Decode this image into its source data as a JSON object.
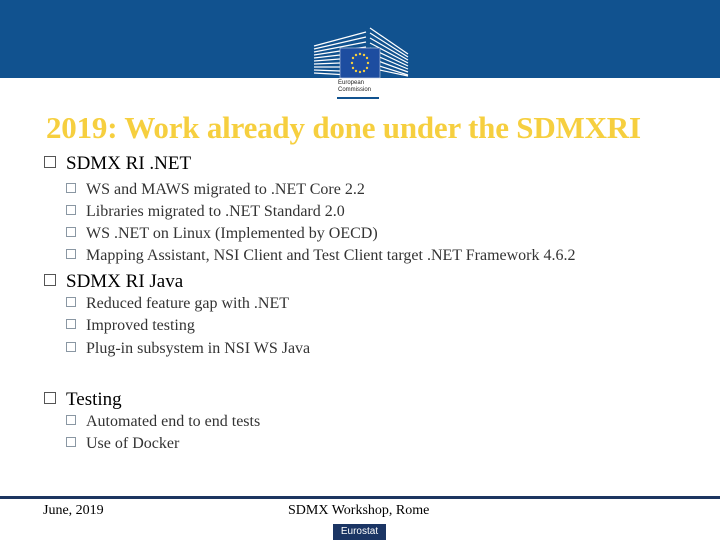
{
  "header": {
    "logo": {
      "name": "european-commission-logo",
      "text_line1": "European",
      "text_line2": "Commission"
    },
    "colors": {
      "banner": "#11528f",
      "title": "#f6cf3f",
      "footer_line": "#1c3560"
    }
  },
  "slide": {
    "title": "2019: Work already done under the SDMXRI",
    "sections": [
      {
        "label": "SDMX RI .NET",
        "items": [
          "WS and MAWS migrated to .NET Core 2.2",
          "Libraries migrated to .NET Standard 2.0",
          "WS .NET on Linux (Implemented by OECD)",
          "Mapping Assistant, NSI Client and Test Client target .NET Framework 4.6.2"
        ]
      },
      {
        "label": "SDMX RI Java",
        "items": [
          "Reduced feature gap with .NET",
          "Improved testing",
          "Plug-in subsystem in NSI WS Java"
        ]
      },
      {
        "label": "Testing",
        "items": [
          "Automated end to end tests",
          "Use of Docker"
        ]
      }
    ]
  },
  "footer": {
    "date": "June, 2019",
    "event": "SDMX Workshop, Rome",
    "badge": "Eurostat"
  }
}
